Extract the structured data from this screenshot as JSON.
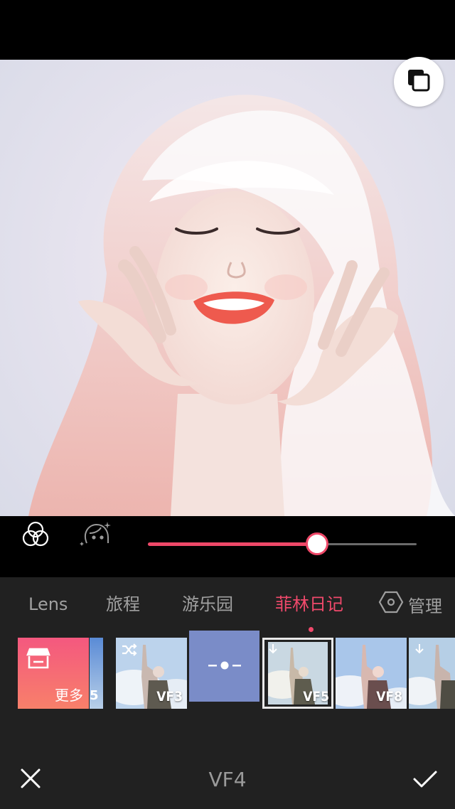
{
  "photo": {
    "compare_icon": "compare-layers-icon"
  },
  "controls": {
    "filter_icon": "filter-circles-icon",
    "face_icon": "face-beauty-icon",
    "intensity": 0.63,
    "accent": "#ee4868"
  },
  "tabs": {
    "items": [
      {
        "label": "Lens"
      },
      {
        "label": "旅程"
      },
      {
        "label": "游乐园"
      },
      {
        "label": "菲林日记"
      }
    ],
    "active_index": 3,
    "manage_label": "管理",
    "manage_icon": "hexagon-settings-icon"
  },
  "filters": {
    "more_label": "更多",
    "more_icon": "store-icon",
    "partial_label": "5",
    "items": [
      {
        "label": "VF3",
        "badge": "shuffle-icon"
      },
      {
        "label": "",
        "badge": ""
      },
      {
        "label": "VF5",
        "badge": "download-icon"
      },
      {
        "label": "VF8",
        "badge": ""
      },
      {
        "label": "",
        "badge": "download-icon"
      }
    ],
    "intensity_icon": "intensity-dots-icon"
  },
  "bottom": {
    "title": "VF4",
    "cancel_icon": "close-icon",
    "confirm_icon": "check-icon"
  }
}
